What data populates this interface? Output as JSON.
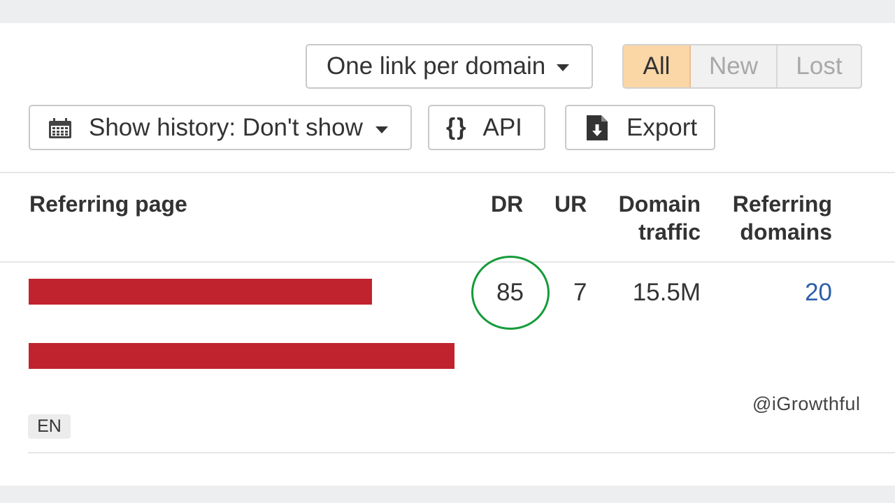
{
  "toolbar": {
    "link_mode_label": "One link per domain",
    "filter_tabs": [
      {
        "label": "All",
        "active": true
      },
      {
        "label": "New",
        "active": false
      },
      {
        "label": "Lost",
        "active": false
      }
    ],
    "history_label": "Show history: Don't show",
    "api_icon": "{}",
    "api_label": "API",
    "export_label": "Export"
  },
  "table": {
    "columns": {
      "referring_page": "Referring page",
      "dr": "DR",
      "ur": "UR",
      "domain_traffic_line1": "Domain",
      "domain_traffic_line2": "traffic",
      "referring_domains_line1": "Referring",
      "referring_domains_line2": "domains"
    },
    "row": {
      "dr": "85",
      "ur": "7",
      "domain_traffic": "15.5M",
      "referring_domains": "20",
      "language": "EN"
    }
  },
  "watermark": "@iGrowthful",
  "colors": {
    "active_tab": "#fbd6a6",
    "highlight_circle": "#169b3a",
    "redaction": "#c0232d",
    "link": "#2d5fa8"
  }
}
